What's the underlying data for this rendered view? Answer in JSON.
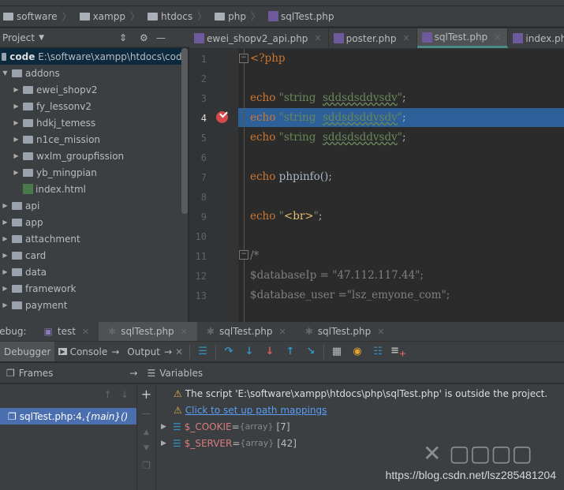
{
  "breadcrumb": [
    "software",
    "xampp",
    "htdocs",
    "php",
    "sqlTest.php"
  ],
  "project": {
    "title": "Project",
    "root_name": "code",
    "root_path": "E:\\software\\xampp\\htdocs\\code",
    "items": [
      {
        "label": "addons",
        "indent": 1,
        "type": "folder",
        "expanded": true
      },
      {
        "label": "ewei_shopv2",
        "indent": 2,
        "type": "folder"
      },
      {
        "label": "fy_lessonv2",
        "indent": 2,
        "type": "folder"
      },
      {
        "label": "hdkj_temess",
        "indent": 2,
        "type": "folder"
      },
      {
        "label": "n1ce_mission",
        "indent": 2,
        "type": "folder"
      },
      {
        "label": "wxlm_groupfission",
        "indent": 2,
        "type": "folder"
      },
      {
        "label": "yb_mingpian",
        "indent": 2,
        "type": "folder"
      },
      {
        "label": "index.html",
        "indent": 2,
        "type": "file"
      },
      {
        "label": "api",
        "indent": 1,
        "type": "folder"
      },
      {
        "label": "app",
        "indent": 1,
        "type": "folder"
      },
      {
        "label": "attachment",
        "indent": 1,
        "type": "folder"
      },
      {
        "label": "card",
        "indent": 1,
        "type": "folder"
      },
      {
        "label": "data",
        "indent": 1,
        "type": "folder"
      },
      {
        "label": "framework",
        "indent": 1,
        "type": "folder"
      },
      {
        "label": "payment",
        "indent": 1,
        "type": "folder"
      }
    ]
  },
  "editor_tabs": [
    {
      "label": "ewei_shopv2_api.php"
    },
    {
      "label": "poster.php"
    },
    {
      "label": "sqlTest.php",
      "active": true
    },
    {
      "label": "index.php"
    }
  ],
  "code": {
    "current_line": 4,
    "breakpoint_line": 4,
    "lines": [
      [
        [
          "kw",
          "<?php"
        ]
      ],
      [],
      [
        [
          "kw",
          "echo "
        ],
        [
          "str",
          "\"string  "
        ],
        [
          "str wavy",
          "sddsdsddvsdv"
        ],
        [
          "str",
          "\""
        ],
        [
          "",
          "; "
        ]
      ],
      [
        [
          "kw",
          "echo "
        ],
        [
          "str",
          "\"string  "
        ],
        [
          "str wavy",
          "sddsdsddvsdv"
        ],
        [
          "str",
          "\""
        ],
        [
          "",
          "; "
        ]
      ],
      [
        [
          "kw",
          "echo "
        ],
        [
          "str",
          "\"string  "
        ],
        [
          "str wavy",
          "sddsdsddvsdv"
        ],
        [
          "str",
          "\""
        ],
        [
          "",
          "; "
        ]
      ],
      [],
      [
        [
          "kw",
          "echo "
        ],
        [
          "",
          "phpinfo();"
        ]
      ],
      [],
      [
        [
          "kw",
          "echo "
        ],
        [
          "str",
          "\""
        ],
        [
          "tag",
          "<br>"
        ],
        [
          "str",
          "\""
        ],
        [
          "",
          ";"
        ]
      ],
      [],
      [
        [
          "cm",
          "/*"
        ]
      ],
      [
        [
          "cm",
          "$databaseIp = \"47.112.117.44\";"
        ]
      ],
      [
        [
          "cm",
          "$database_user =\"lsz_emyone_com\";"
        ]
      ]
    ]
  },
  "debug": {
    "label": "Debug:",
    "tabs": [
      {
        "label": "test"
      },
      {
        "label": "sqlTest.php",
        "active": true
      },
      {
        "label": "sqlTest.php"
      },
      {
        "label": "sqlTest.php"
      }
    ],
    "toolbar": {
      "debugger": "Debugger",
      "console": "Console",
      "output": "Output"
    },
    "frames_title": "Frames",
    "variables_title": "Variables",
    "frame": "sqlTest.php:4, ",
    "frame_fn": "{main}()",
    "warning": "The script 'E:\\software\\xampp\\htdocs\\php\\sqlTest.php' is outside the project.",
    "mapping_link": "Click to set up path mappings",
    "variables": [
      {
        "name": "$_COOKIE",
        "type": "{array}",
        "count": "[7]"
      },
      {
        "name": "$_SERVER",
        "type": "{array}",
        "count": "[42]"
      }
    ]
  },
  "watermark": {
    "url": "https://blog.csdn.net/lsz285481204",
    "logo": "自由互联"
  }
}
